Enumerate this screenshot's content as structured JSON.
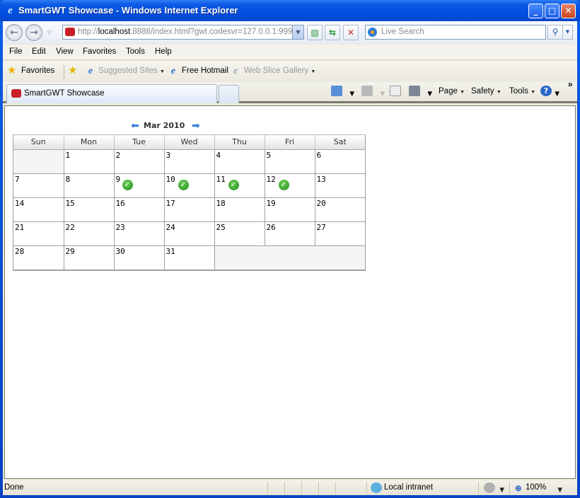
{
  "window": {
    "title": "SmartGWT Showcase - Windows Internet Explorer",
    "controls": {
      "minimize": "_",
      "maximize": "□",
      "close": "✕"
    }
  },
  "addressbar": {
    "url_prefix": "http://",
    "url_host": "localhost",
    "url_rest": ":8888/index.html?gwt.codesvr=127.0.0.1:999",
    "search_placeholder": "Live Search"
  },
  "menubar": {
    "items": [
      "File",
      "Edit",
      "View",
      "Favorites",
      "Tools",
      "Help"
    ]
  },
  "favoritesbar": {
    "favorites_label": "Favorites",
    "links": [
      {
        "label": "Suggested Sites",
        "dimmed": true,
        "dropdown": true
      },
      {
        "label": "Free Hotmail",
        "dimmed": false,
        "dropdown": false
      },
      {
        "label": "Web Slice Gallery",
        "dimmed": true,
        "dropdown": true
      }
    ]
  },
  "tabs": {
    "active_tab": "SmartGWT Showcase"
  },
  "commandbar": {
    "page": "Page",
    "safety": "Safety",
    "tools": "Tools",
    "overflow": "»"
  },
  "calendar": {
    "month_label": "Mar 2010",
    "weekdays": [
      "Sun",
      "Mon",
      "Tue",
      "Wed",
      "Thu",
      "Fri",
      "Sat"
    ],
    "weeks": [
      [
        "",
        "1",
        "2",
        "3",
        "4",
        "5",
        "6"
      ],
      [
        "7",
        "8",
        "9",
        "10",
        "11",
        "12",
        "13"
      ],
      [
        "14",
        "15",
        "16",
        "17",
        "18",
        "19",
        "20"
      ],
      [
        "21",
        "22",
        "23",
        "24",
        "25",
        "26",
        "27"
      ],
      [
        "28",
        "29",
        "30",
        "31",
        "",
        "",
        ""
      ]
    ],
    "days_with_events": [
      "9",
      "10",
      "11",
      "12"
    ]
  },
  "statusbar": {
    "status": "Done",
    "zone": "Local intranet",
    "zoom": "100%"
  }
}
